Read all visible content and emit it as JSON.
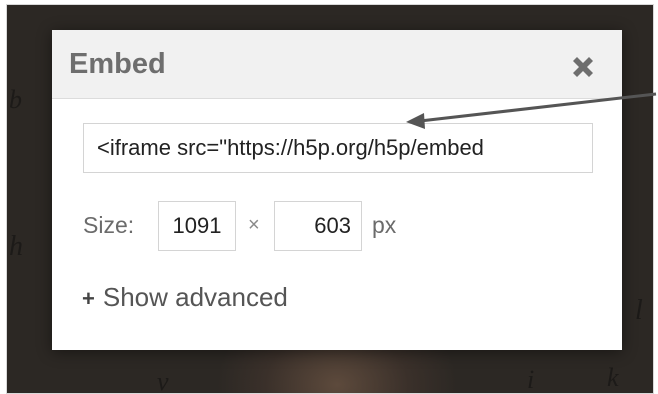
{
  "dialog": {
    "title": "Embed",
    "close_icon": "close-icon",
    "embed_code_value": "<iframe src=\"https://h5p.org/h5p/embed",
    "size": {
      "label": "Size:",
      "width_value": "1091",
      "times": "×",
      "height_value": "603",
      "unit": "px"
    },
    "advanced_toggle": {
      "icon": "+",
      "label": "Show advanced"
    }
  },
  "colors": {
    "header_bg": "#f1f1f1",
    "title_color": "#6e6e6e",
    "annotation_arrow": "#555555"
  }
}
